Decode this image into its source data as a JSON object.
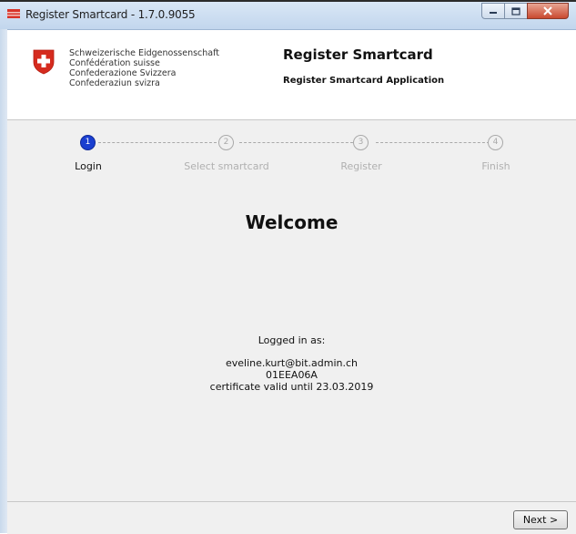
{
  "window": {
    "title": "Register Smartcard - 1.7.0.9055",
    "controls": [
      "minimize-icon",
      "maximize-icon",
      "close-icon"
    ]
  },
  "header": {
    "confederation_lines": [
      "Schweizerische Eidgenossenschaft",
      "Confédération suisse",
      "Confederazione Svizzera",
      "Confederaziun svizra"
    ],
    "title": "Register Smartcard",
    "subtitle": "Register Smartcard Application"
  },
  "steps": [
    {
      "number": "1",
      "label": "Login",
      "active": true
    },
    {
      "number": "2",
      "label": "Select smartcard",
      "active": false
    },
    {
      "number": "3",
      "label": "Register",
      "active": false
    },
    {
      "number": "4",
      "label": "Finish",
      "active": false
    }
  ],
  "main": {
    "welcome": "Welcome",
    "logged_in_label": "Logged in as:",
    "user_email": "eveline.kurt@bit.admin.ch",
    "card_id": "01EEA06A",
    "cert_validity": "certificate valid until 23.03.2019"
  },
  "footer": {
    "next_label": "Next >"
  },
  "colors": {
    "active_step": "#1a3fd0",
    "swiss_red": "#d52b1e"
  }
}
